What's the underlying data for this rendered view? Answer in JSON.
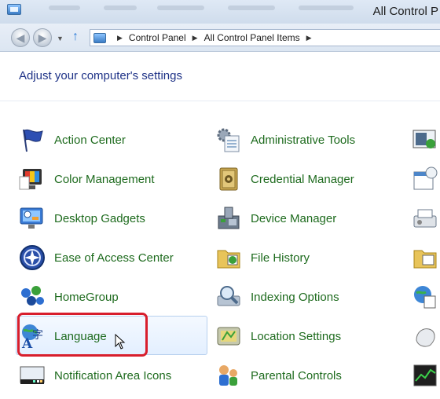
{
  "window": {
    "title": "All Control P"
  },
  "address_bar": {
    "breadcrumbs": [
      "Control Panel",
      "All Control Panel Items"
    ]
  },
  "heading": "Adjust your computer's settings",
  "items": {
    "col1": [
      {
        "label": "Action Center",
        "icon": "flag-icon"
      },
      {
        "label": "Color Management",
        "icon": "color-monitor-icon"
      },
      {
        "label": "Desktop Gadgets",
        "icon": "gadgets-icon"
      },
      {
        "label": "Ease of Access Center",
        "icon": "ease-of-access-icon"
      },
      {
        "label": "HomeGroup",
        "icon": "homegroup-icon"
      },
      {
        "label": "Language",
        "icon": "language-icon"
      },
      {
        "label": "Notification Area Icons",
        "icon": "notification-area-icon"
      }
    ],
    "col2": [
      {
        "label": "Administrative Tools",
        "icon": "admin-tools-icon"
      },
      {
        "label": "Credential Manager",
        "icon": "credential-vault-icon"
      },
      {
        "label": "Device Manager",
        "icon": "device-manager-icon"
      },
      {
        "label": "File History",
        "icon": "file-history-icon"
      },
      {
        "label": "Indexing Options",
        "icon": "indexing-icon"
      },
      {
        "label": "Location Settings",
        "icon": "location-icon"
      },
      {
        "label": "Parental Controls",
        "icon": "parental-controls-icon"
      }
    ]
  },
  "colors": {
    "link": "#1e6b1e",
    "heading": "#1e3287",
    "highlight": "#d81e2c"
  }
}
